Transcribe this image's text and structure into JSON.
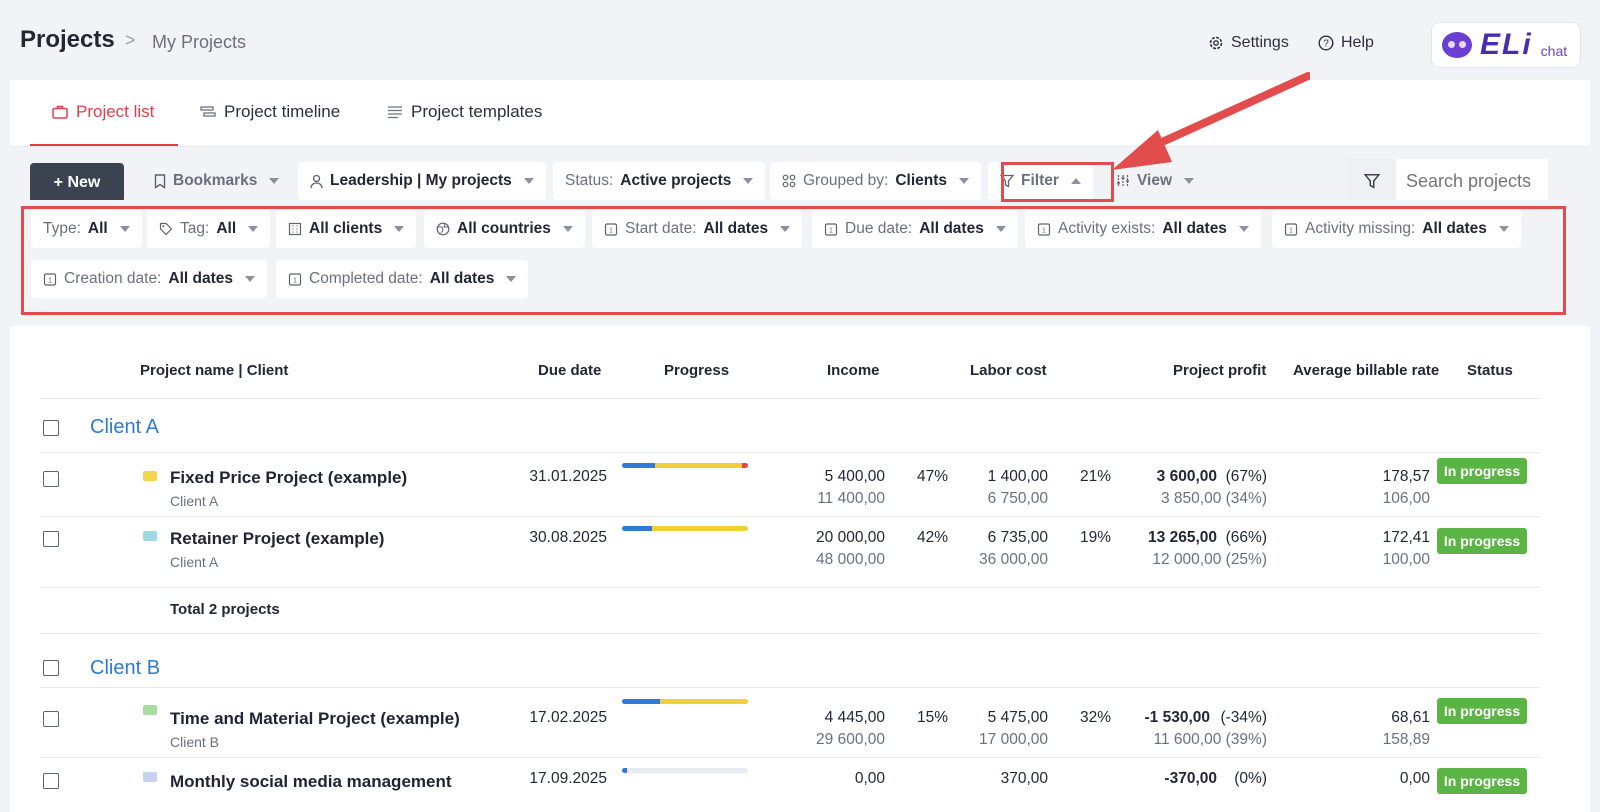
{
  "header": {
    "title": "Projects",
    "separator": ">",
    "subtitle": "My Projects",
    "settings_label": "Settings",
    "help_label": "Help",
    "eli_logo": "ELi",
    "eli_chat": "chat"
  },
  "tabs": [
    {
      "label": "Project list",
      "icon": "briefcase-icon",
      "active": true
    },
    {
      "label": "Project timeline",
      "icon": "timeline-icon",
      "active": false
    },
    {
      "label": "Project templates",
      "icon": "list-icon",
      "active": false
    }
  ],
  "toolbar": {
    "new_label": "+ New",
    "bookmarks_label": "Bookmarks",
    "view_name": "Leadership | My projects",
    "status_key": "Status:",
    "status_value": "Active projects",
    "grouped_key": "Grouped by:",
    "grouped_value": "Clients",
    "filter_label": "Filter",
    "view_label": "View",
    "search_placeholder": "Search projects"
  },
  "filters": {
    "type_key": "Type:",
    "type_value": "All",
    "tag_key": "Tag:",
    "tag_value": "All",
    "clients_value": "All clients",
    "countries_value": "All countries",
    "start_key": "Start date:",
    "start_value": "All dates",
    "due_key": "Due date:",
    "due_value": "All dates",
    "activity_exists_key": "Activity exists:",
    "activity_exists_value": "All dates",
    "activity_missing_key": "Activity missing:",
    "activity_missing_value": "All dates",
    "creation_key": "Creation date:",
    "creation_value": "All dates",
    "completed_key": "Completed date:",
    "completed_value": "All dates"
  },
  "table": {
    "columns": {
      "name": "Project name | Client",
      "due": "Due date",
      "progress": "Progress",
      "income": "Income",
      "labor": "Labor cost",
      "profit": "Project profit",
      "rate": "Average billable rate",
      "status": "Status"
    },
    "groups": [
      {
        "client": "Client A",
        "total": "Total 2 projects",
        "rows": [
          {
            "name": "Fixed Price Project (example)",
            "client": "Client A",
            "due": "31.01.2025",
            "progress": {
              "blue": 0.26,
              "yellow": 0.69,
              "red": 0.05
            },
            "income": "5 400,00",
            "income_sub": "11 400,00",
            "income_pct": "47%",
            "labor": "1 400,00",
            "labor_sub": "6 750,00",
            "labor_pct": "21%",
            "profit": "3 600,00",
            "profit_pct": "(67%)",
            "profit_sub": "3 850,00 (34%)",
            "rate": "178,57",
            "rate_sub": "106,00",
            "status": "In progress",
            "icon_color": "#f4d34f"
          },
          {
            "name": "Retainer Project (example)",
            "client": "Client A",
            "due": "30.08.2025",
            "progress": {
              "blue": 0.24,
              "yellow": 0.76,
              "red": 0
            },
            "income": "20 000,00",
            "income_sub": "48 000,00",
            "income_pct": "42%",
            "labor": "6 735,00",
            "labor_sub": "36 000,00",
            "labor_pct": "19%",
            "profit": "13 265,00",
            "profit_pct": "(66%)",
            "profit_sub": "12 000,00 (25%)",
            "rate": "172,41",
            "rate_sub": "100,00",
            "status": "In progress",
            "icon_color": "#9fd9e6"
          }
        ]
      },
      {
        "client": "Client B",
        "rows": [
          {
            "name": "Time and Material Project (example)",
            "client": "Client B",
            "due": "17.02.2025",
            "progress": {
              "blue": 0.3,
              "yellow": 0.7,
              "red": 0
            },
            "income": "4 445,00",
            "income_sub": "29 600,00",
            "income_pct": "15%",
            "labor": "5 475,00",
            "labor_sub": "17 000,00",
            "labor_pct": "32%",
            "profit": "-1 530,00",
            "profit_pct": "(-34%)",
            "profit_sub": "11 600,00 (39%)",
            "rate": "68,61",
            "rate_sub": "158,89",
            "status": "In progress",
            "icon_color": "#a9dca0"
          },
          {
            "name": "Monthly social media management",
            "client": "",
            "due": "17.09.2025",
            "progress": {
              "blue": 0.04,
              "yellow": 0,
              "red": 0
            },
            "income": "0,00",
            "income_sub": "",
            "income_pct": "",
            "labor": "370,00",
            "labor_sub": "",
            "labor_pct": "",
            "profit": "-370,00",
            "profit_pct": "(0%)",
            "profit_sub": "",
            "rate": "0,00",
            "rate_sub": "",
            "status": "In progress",
            "icon_color": "#c5d3f0"
          }
        ]
      }
    ]
  },
  "colors": {
    "accent": "#df3f4b",
    "link": "#2d7bd4",
    "status": "#5bb544",
    "progress_blue": "#2f7ad6",
    "progress_yellow": "#f2cf38",
    "progress_red": "#e0463f",
    "highlight": "#e24c4c"
  }
}
